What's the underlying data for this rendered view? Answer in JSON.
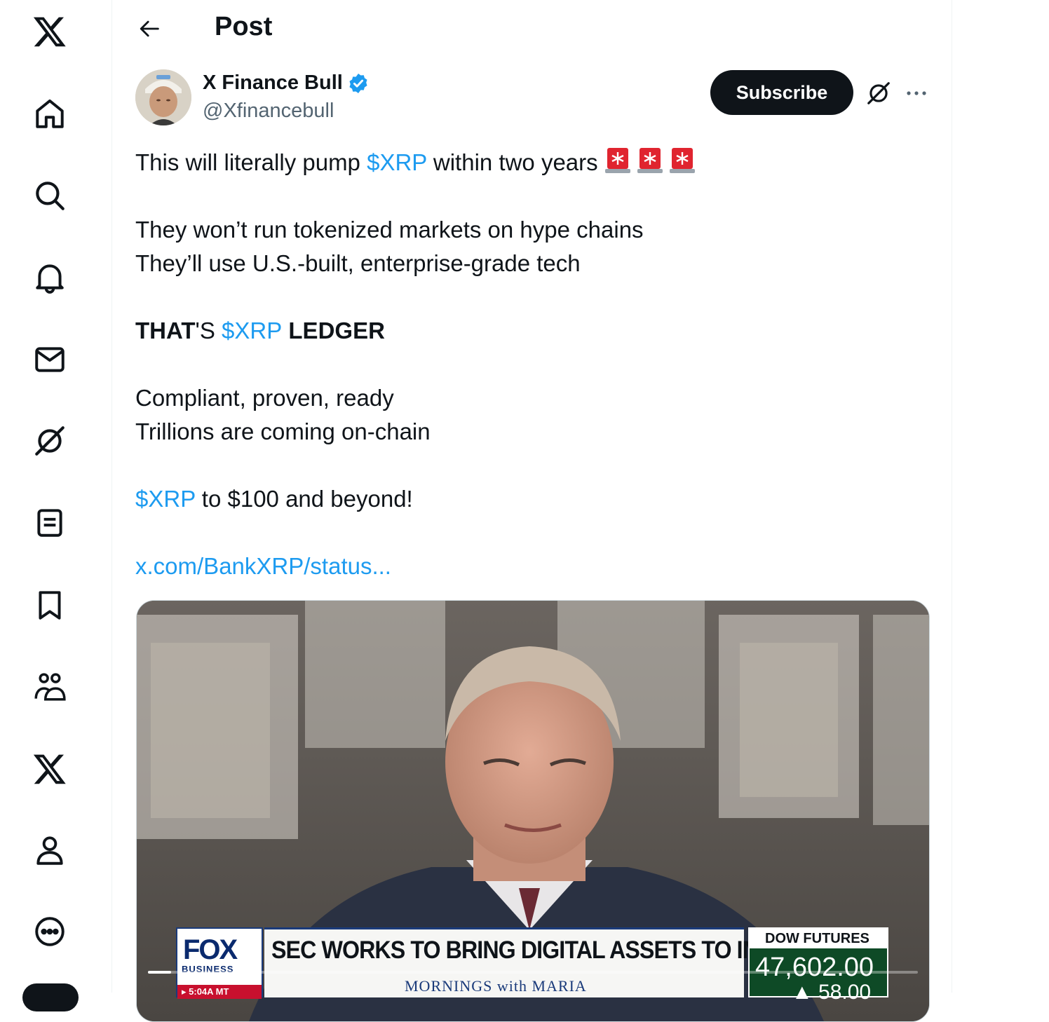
{
  "header": {
    "title": "Post"
  },
  "nav": {
    "items": [
      "x-logo",
      "home",
      "explore",
      "notifications",
      "messages",
      "grok",
      "lists",
      "bookmarks",
      "communities",
      "premium",
      "profile",
      "more"
    ]
  },
  "author": {
    "name": "X Finance Bull",
    "handle": "@Xfinancebull",
    "verified": true
  },
  "actions": {
    "subscribe_label": "Subscribe"
  },
  "post": {
    "l1_a": "This will literally pump ",
    "l1_tag": "$XRP",
    "l1_b": " within two years ",
    "l2": "They won’t run tokenized markets on hype chains",
    "l3": "They’ll use U.S.-built, enterprise-grade tech",
    "l4_a": "THAT",
    "l4_b": "'S ",
    "l4_tag": "$XRP",
    "l4_c": " LEDGER",
    "l5": "Compliant, proven, ready",
    "l6": "Trillions are coming on-chain",
    "l7_tag": "$XRP",
    "l7_b": " to $100 and beyond!",
    "link": "x.com/BankXRP/status..."
  },
  "media": {
    "fox_word": "FOX",
    "fox_sub": "BUSINESS",
    "time": "▸ 5:04A MT",
    "headline": "SEC WORKS TO BRING DIGITAL ASSETS TO INVESTORS",
    "show": "MORNINGS with MARIA",
    "ticker_label": "DOW FUTURES",
    "ticker_value": "47,602.00",
    "ticker_change": "▲ 58.00",
    "progress": 0.03
  },
  "colors": {
    "accent": "#1d9bf0",
    "text": "#0f1419",
    "muted": "#536471"
  }
}
